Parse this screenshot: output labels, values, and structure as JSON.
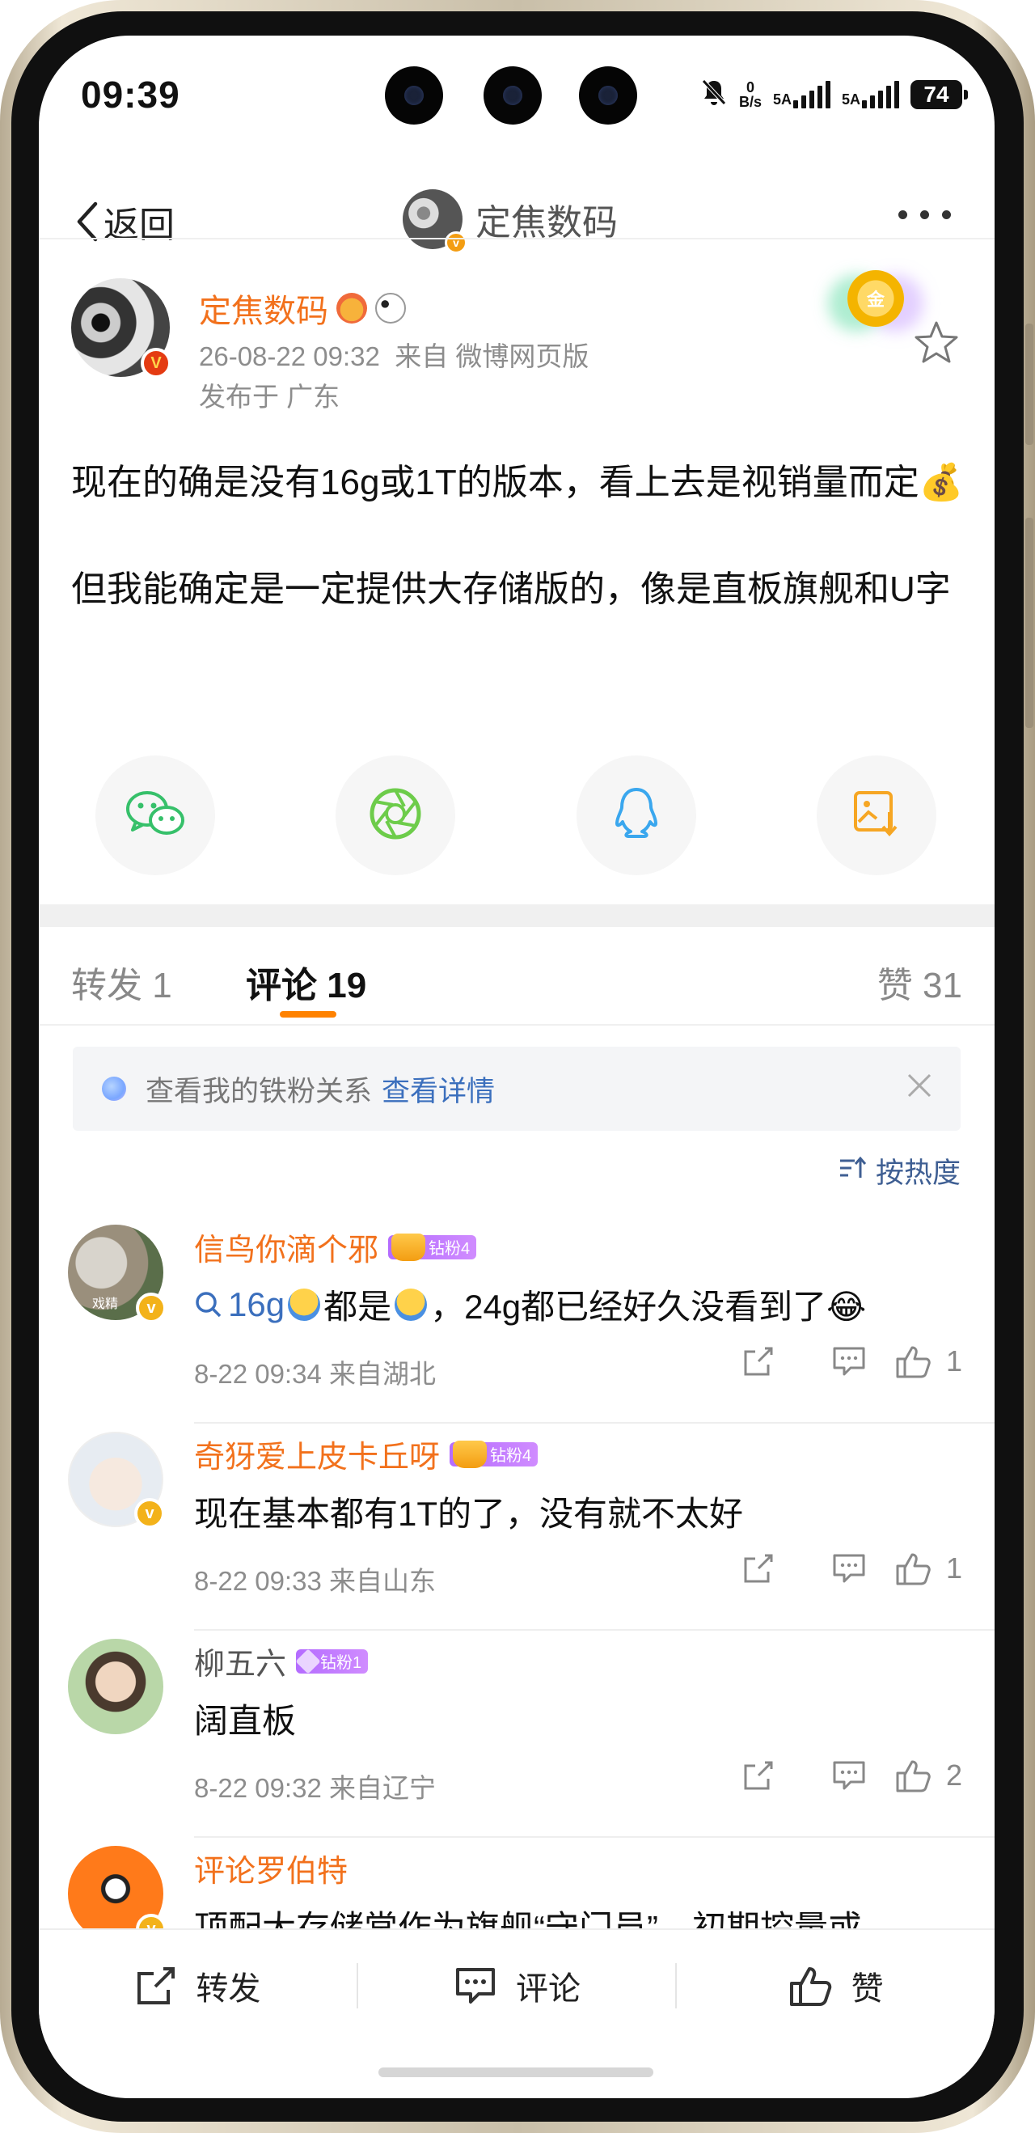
{
  "status_bar": {
    "time": "09:39",
    "net_speed_top": "0",
    "net_speed_bottom": "B/s",
    "signal1": "5A",
    "signal2": "5A",
    "battery": "74"
  },
  "nav": {
    "back_label": "返回",
    "title": "定焦数码"
  },
  "post": {
    "author": "定焦数码",
    "date": "26-08-22 09:32",
    "source": "来自 微博网页版",
    "location": "发布于 广东",
    "medal_text": "金",
    "paragraph1": "现在的确是没有16g或1T的版本，看上去是视销量而定💰",
    "paragraph2": "但我能确定是一定提供大存储版的，像是直板旗舰和U字"
  },
  "share_icons": [
    "wechat-icon",
    "moments-icon",
    "qq-icon",
    "save-image-icon"
  ],
  "tabs": {
    "repost": "转发 1",
    "comments": "评论 19",
    "likes": "赞 31"
  },
  "fan_bar": {
    "text": "查看我的铁粉关系",
    "link": "查看详情"
  },
  "sort_label": "按热度",
  "comments": [
    {
      "name": "信鸟你滴个邪",
      "badge": "钻粉4",
      "avatar_label": "戏精",
      "topic": "16g",
      "text_mid": "都是",
      "text_end": "，24g都已经好久没看到了😂",
      "meta": "8-22 09:34 来自湖北",
      "likes": "1"
    },
    {
      "name": "奇犽爱上皮卡丘呀",
      "badge": "钻粉4",
      "text": "现在基本都有1T的了，没有就不太好",
      "meta": "8-22 09:33 来自山东",
      "likes": "1"
    },
    {
      "name": "柳五六",
      "badge": "钻粉1",
      "text": "阔直板",
      "meta": "8-22 09:32 来自辽宁",
      "likes": "2"
    },
    {
      "name": "评论罗伯特",
      "text": "顶配大存储常作为旗舰“守门员”，初期控量或"
    }
  ],
  "bottom_bar": {
    "repost": "转发",
    "comment": "评论",
    "like": "赞"
  },
  "colors": {
    "accent_orange": "#f2711c",
    "link_blue": "#3b6fbd",
    "tab_underline": "#ff8200",
    "wechat_green": "#36c06a",
    "moments_green": "#6dcc4a",
    "qq_blue": "#3aa7ee",
    "save_orange": "#f6a623"
  }
}
